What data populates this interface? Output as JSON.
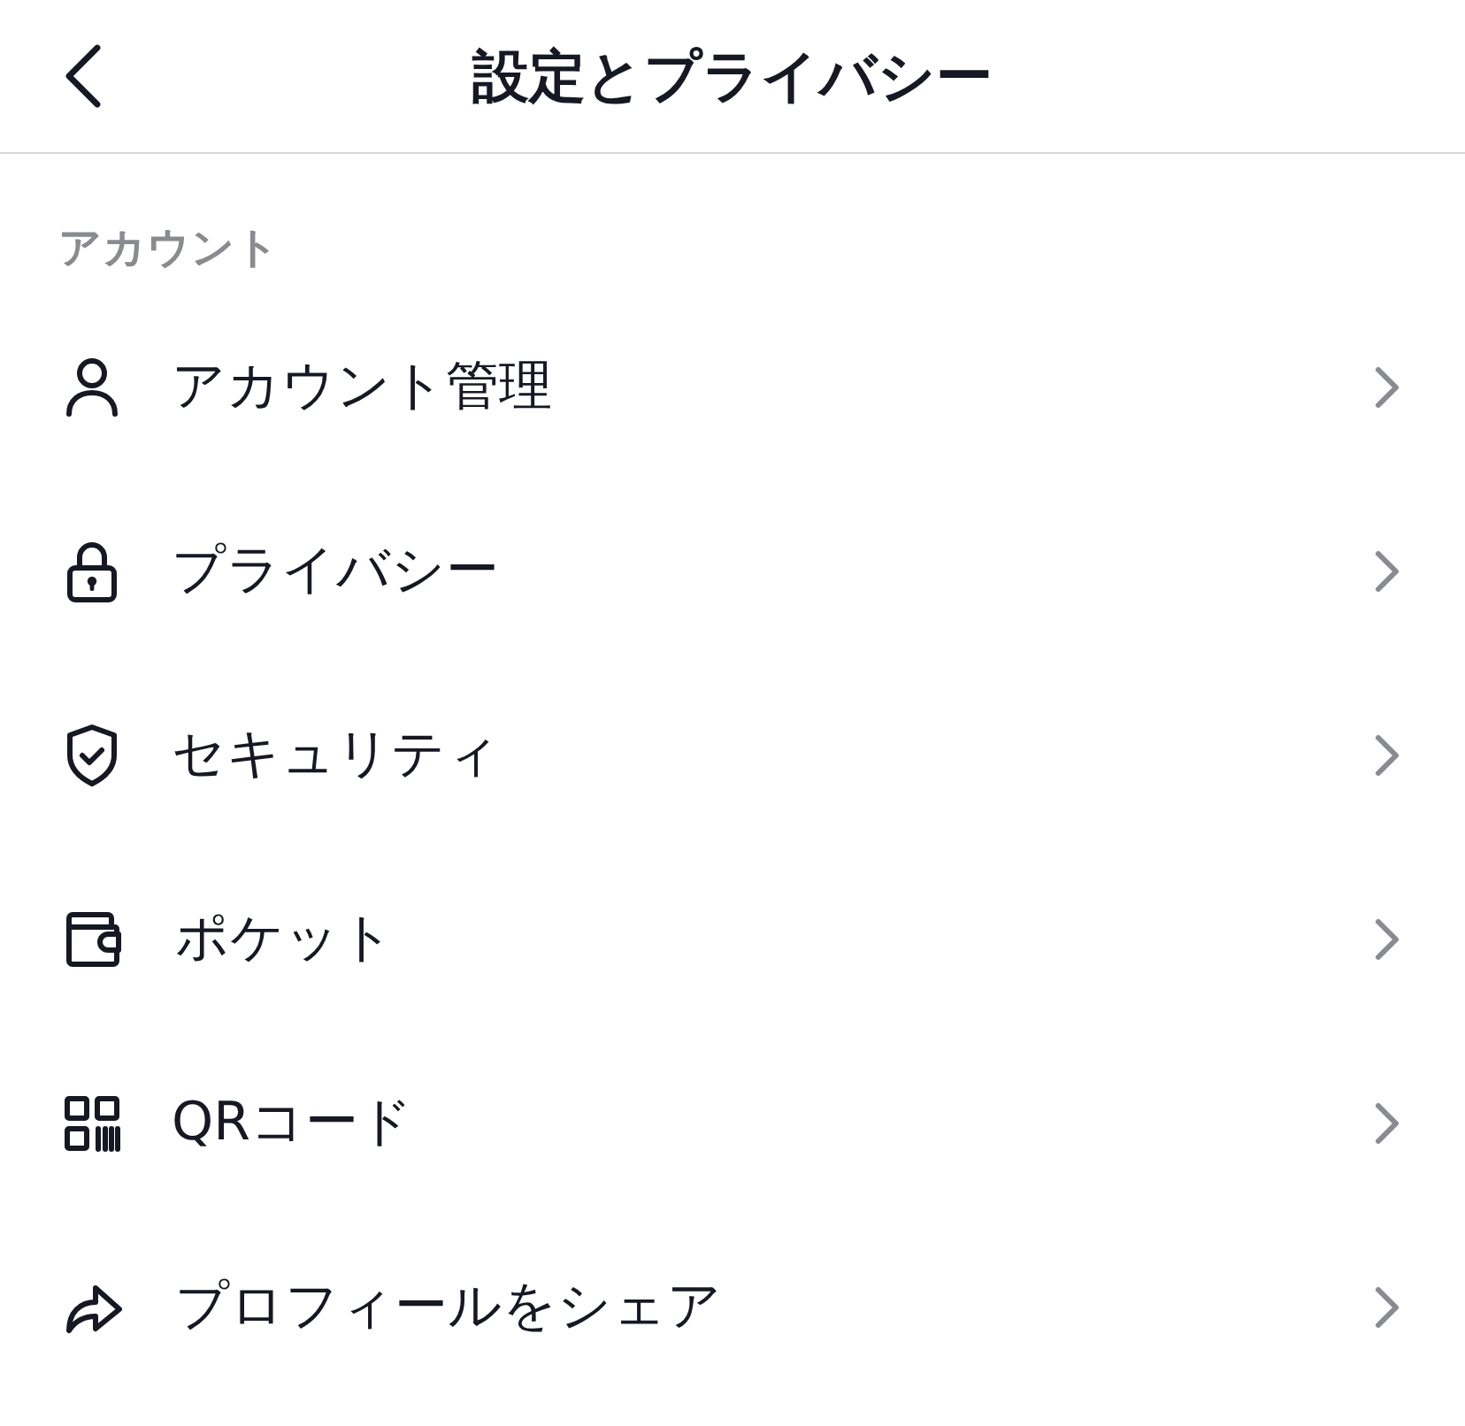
{
  "header": {
    "title": "設定とプライバシー"
  },
  "sections": [
    {
      "title": "アカウント",
      "items": [
        {
          "label": "アカウント管理"
        },
        {
          "label": "プライバシー"
        },
        {
          "label": "セキュリティ"
        },
        {
          "label": "ポケット"
        },
        {
          "label": "QRコード"
        },
        {
          "label": "プロフィールをシェア"
        }
      ]
    }
  ]
}
